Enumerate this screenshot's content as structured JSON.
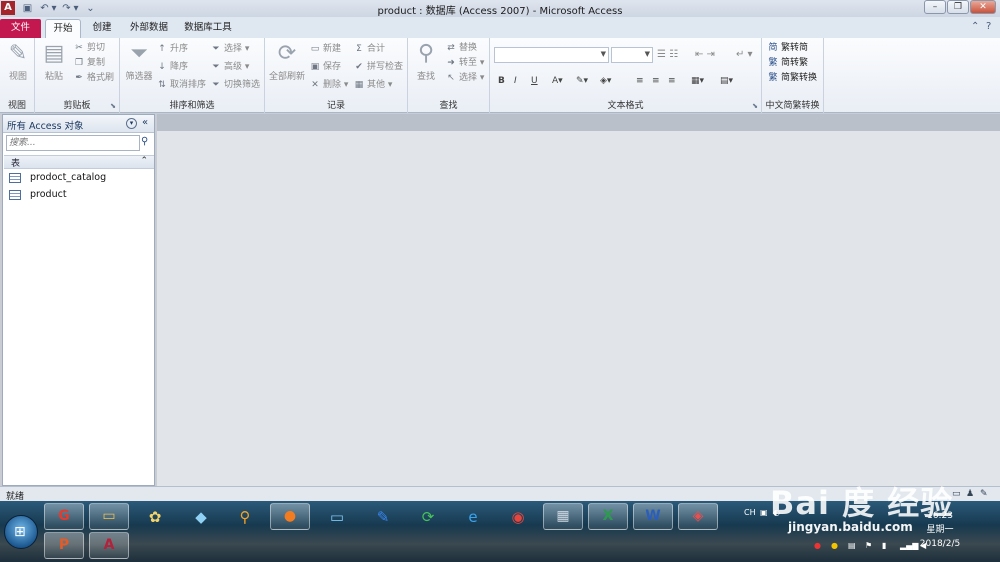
{
  "window": {
    "title": "product : 数据库 (Access 2007) - Microsoft Access",
    "app_icon_letter": "A",
    "minimize": "–",
    "restore": "❐",
    "close": "✕"
  },
  "quick_access": [
    "save-icon",
    "undo-icon",
    "redo-icon",
    "customize-icon"
  ],
  "tabs": [
    {
      "label": "文件"
    },
    {
      "label": "开始"
    },
    {
      "label": "创建"
    },
    {
      "label": "外部数据"
    },
    {
      "label": "数据库工具"
    }
  ],
  "ribbon": {
    "view_group": {
      "label": "视图",
      "view_button": "视图"
    },
    "clipboard_group": {
      "label": "剪贴板",
      "paste": "粘贴",
      "cut": "剪切",
      "copy": "复制",
      "format_painter": "格式刷"
    },
    "sort_group": {
      "label": "排序和筛选",
      "filter": "筛选器",
      "ascending": "升序",
      "descending": "降序",
      "remove_sort": "取消排序",
      "selection": "选择",
      "advanced": "高级",
      "toggle_filter": "切换筛选"
    },
    "records_group": {
      "label": "记录",
      "refresh_all": "全部刷新",
      "new": "新建",
      "save": "保存",
      "delete": "删除",
      "totals": "合计",
      "spelling": "拼写检查",
      "more": "其他"
    },
    "find_group": {
      "label": "查找",
      "find": "查找",
      "replace": "替换",
      "goto": "转至",
      "select": "选择"
    },
    "text_format_group": {
      "label": "文本格式",
      "bold": "B",
      "italic": "I",
      "underline": "U"
    },
    "chinese_group": {
      "label": "中文简繁转换",
      "to_simplified": "繁转简",
      "to_traditional": "简转繁",
      "convert": "简繁转换"
    }
  },
  "nav_pane": {
    "title": "所有 Access 对象",
    "search_placeholder": "搜索...",
    "group_label": "表",
    "items": [
      {
        "label": "prodoct_catalog"
      },
      {
        "label": "product"
      }
    ]
  },
  "statusbar": {
    "text": "就绪"
  },
  "taskbar": {
    "tray_lang": "CH",
    "time": "16:23",
    "weekday": "星期一",
    "date": "2018/2/5"
  },
  "watermark": {
    "logo": "Bai 度 经验",
    "url": "jingyan.baidu.com"
  },
  "colors": {
    "file_tab": "#c3174f",
    "accent": "#a4262c"
  }
}
